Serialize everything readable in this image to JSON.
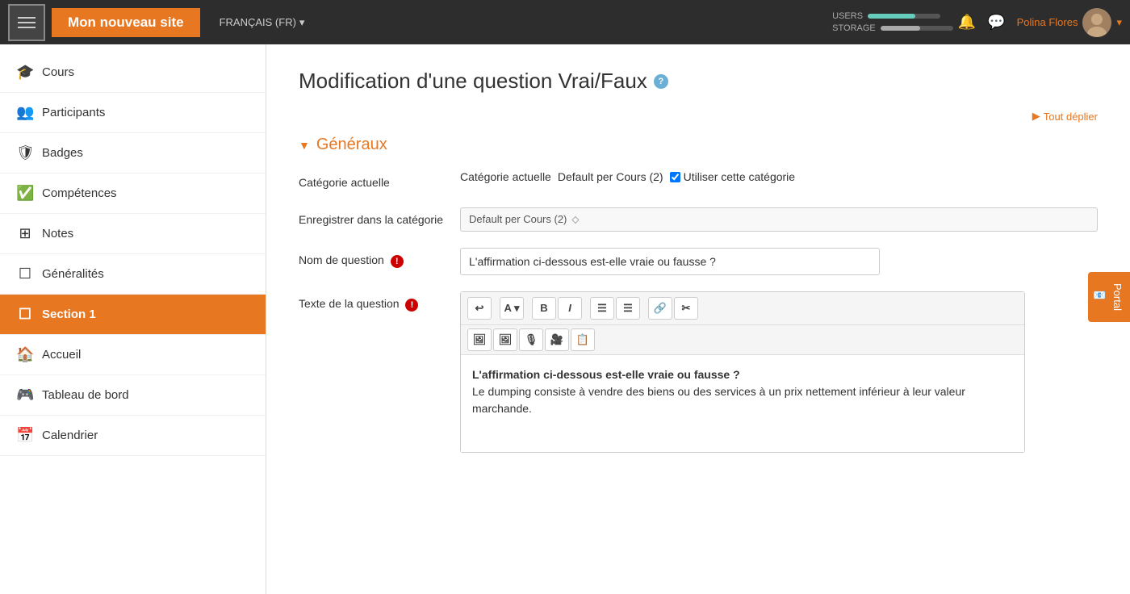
{
  "topnav": {
    "logo": "Mon nouveau site",
    "lang": "FRANÇAIS (FR)",
    "lang_arrow": "▾",
    "users_label": "USERS",
    "storage_label": "STORAGE",
    "user_name": "Polina Flores",
    "users_pct": 65,
    "storage_pct": 55
  },
  "sidebar": {
    "items": [
      {
        "id": "cours",
        "icon": "🎓",
        "label": "Cours",
        "active": false
      },
      {
        "id": "participants",
        "icon": "👥",
        "label": "Participants",
        "active": false
      },
      {
        "id": "badges",
        "icon": "🛡",
        "label": "Badges",
        "active": false
      },
      {
        "id": "competences",
        "icon": "✅",
        "label": "Compétences",
        "active": false
      },
      {
        "id": "notes",
        "icon": "⊞",
        "label": "Notes",
        "active": false
      },
      {
        "id": "generalites",
        "icon": "☐",
        "label": "Généralités",
        "active": false
      },
      {
        "id": "section1",
        "icon": "☐",
        "label": "Section 1",
        "active": true
      },
      {
        "id": "accueil",
        "icon": "🏠",
        "label": "Accueil",
        "active": false
      },
      {
        "id": "tableau",
        "icon": "🎮",
        "label": "Tableau de bord",
        "active": false
      },
      {
        "id": "calendrier",
        "icon": "📅",
        "label": "Calendrier",
        "active": false
      }
    ]
  },
  "main": {
    "page_title": "Modification d'une question Vrai/Faux",
    "help_icon": "?",
    "tout_deplier": "Tout déplier",
    "section_generaux": "Généraux",
    "label_categorie": "Catégorie actuelle",
    "category_text": "Catégorie actuelle",
    "category_value": "Default per Cours (2)",
    "checkbox_label": "Utiliser cette catégorie",
    "label_enregistrer": "Enregistrer dans la catégorie",
    "dropdown_value": "Default per Cours (2)",
    "label_nom": "Nom de question",
    "nom_value": "L'affirmation ci-dessous est-elle vraie ou fausse ?",
    "label_texte": "Texte de la question",
    "editor_bold_content": "L'affirmation ci-dessous est-elle vraie ou fausse ?",
    "editor_paragraph": "Le dumping consiste à vendre des biens ou des services à un prix nettement inférieur à leur valeur marchande.",
    "toolbar_buttons": [
      "↩",
      "A",
      "B",
      "I",
      "☰",
      "☰",
      "🔗",
      "✂"
    ],
    "toolbar2_buttons": [
      "🖼",
      "🖼",
      "🎙",
      "🎥",
      "📋"
    ]
  },
  "portal": {
    "label": "Portal"
  }
}
